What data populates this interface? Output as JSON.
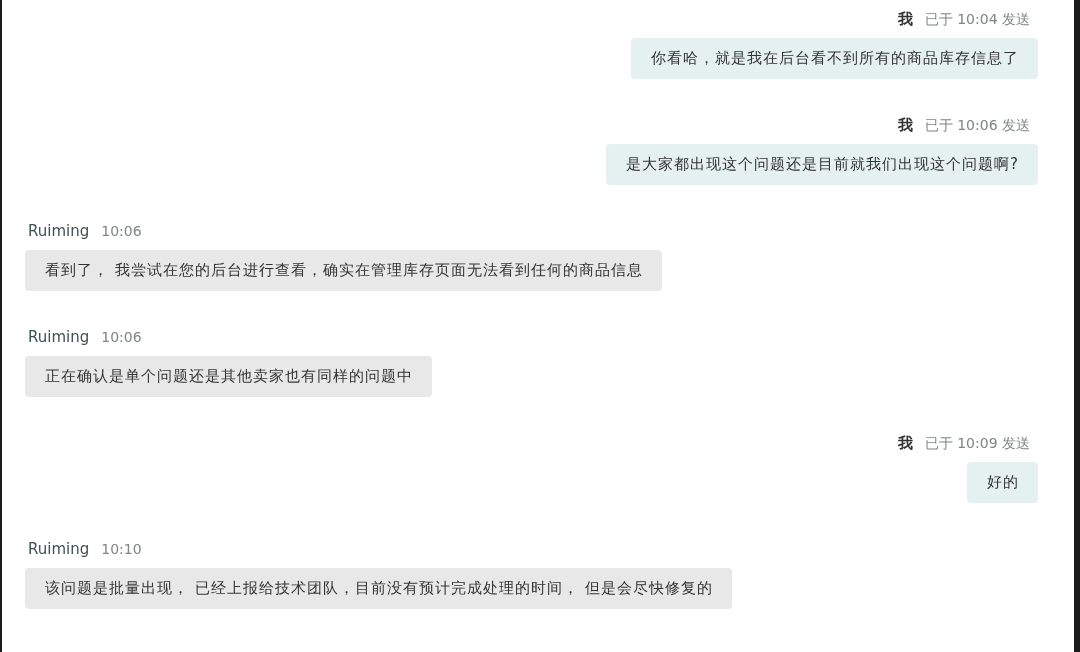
{
  "messages": [
    {
      "kind": "out",
      "sender": "我",
      "timestamp": "已于 10:04 发送",
      "text": "你看哈，就是我在后台看不到所有的商品库存信息了"
    },
    {
      "kind": "out",
      "sender": "我",
      "timestamp": "已于 10:06 发送",
      "text": "是大家都出现这个问题还是目前就我们出现这个问题啊?"
    },
    {
      "kind": "in",
      "sender": "Ruiming",
      "timestamp": "10:06",
      "text": "看到了， 我尝试在您的后台进行查看，确实在管理库存页面无法看到任何的商品信息"
    },
    {
      "kind": "in",
      "sender": "Ruiming",
      "timestamp": "10:06",
      "text": "正在确认是单个问题还是其他卖家也有同样的问题中"
    },
    {
      "kind": "out",
      "sender": "我",
      "timestamp": "已于 10:09 发送",
      "text": "好的"
    },
    {
      "kind": "in",
      "sender": "Ruiming",
      "timestamp": "10:10",
      "text": "该问题是批量出现， 已经上报给技术团队，目前没有预计完成处理的时间， 但是会尽快修复的"
    }
  ]
}
